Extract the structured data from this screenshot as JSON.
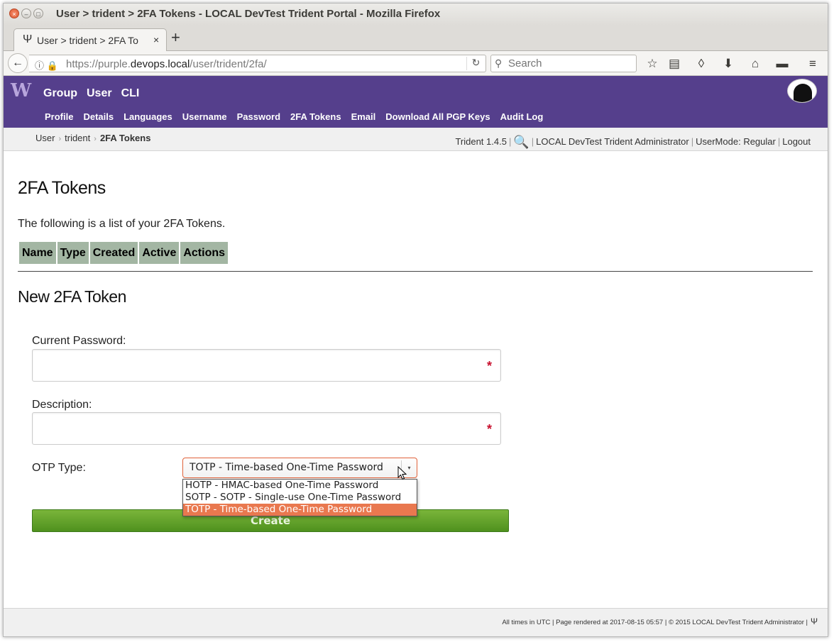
{
  "window": {
    "title": "User > trident > 2FA Tokens - LOCAL DevTest Trident Portal - Mozilla Firefox",
    "controls": {
      "close": "×",
      "minimize": "–",
      "maximize": "□"
    }
  },
  "browser": {
    "tab_icon": "Ψ",
    "tab_label": "User > trident > 2FA To",
    "tab_close": "×",
    "new_tab": "+",
    "back": "←",
    "url_security_icons": "ⓘ 🔒",
    "url_prefix": "https://purple.",
    "url_domain": "devops.local",
    "url_path": "/user/trident/2fa/",
    "reload": "↻",
    "search_icon": "⚲",
    "search_placeholder": "Search",
    "toolbar_icons": [
      "☆",
      "▤",
      "◊",
      "⬇",
      "⌂",
      "▬",
      "≡"
    ]
  },
  "site": {
    "logo": "W",
    "top_nav": [
      "Group",
      "User",
      "CLI"
    ],
    "sub_nav": [
      "Profile",
      "Details",
      "Languages",
      "Username",
      "Password",
      "2FA Tokens",
      "Email",
      "Download All PGP Keys",
      "Audit Log"
    ],
    "breadcrumb": {
      "items": [
        "User",
        "trident"
      ],
      "current": "2FA Tokens",
      "separator": "›"
    },
    "version": "Trident 1.4.5",
    "search_icon": "🔍",
    "admin_name": "LOCAL DevTest Trident Administrator",
    "usermode_label": "UserMode:",
    "usermode_value": "Regular",
    "logout": "Logout",
    "pipe": "|"
  },
  "page": {
    "title": "2FA Tokens",
    "intro": "The following is a list of your 2FA Tokens.",
    "table_headers": [
      "Name",
      "Type",
      "Created",
      "Active",
      "Actions"
    ],
    "new_title": "New 2FA Token",
    "form": {
      "current_password_label": "Current Password:",
      "description_label": "Description:",
      "required_mark": "*",
      "otp_type_label": "OTP Type:",
      "otp_selected": "TOTP - Time-based One-Time Password",
      "otp_options": [
        "HOTP - HMAC-based One-Time Password",
        "SOTP - SOTP - Single-use One-Time Password",
        "TOTP - Time-based One-Time Password"
      ],
      "otp_highlighted_index": 2,
      "select_arrow": "▾",
      "create_label": "Create"
    }
  },
  "footer": {
    "text": "All times in UTC | Page rendered at 2017-08-15 05:57 | © 2015 LOCAL DevTest Trident Administrator |",
    "logo": "Ψ"
  },
  "colors": {
    "site_header": "#553f8c",
    "table_header": "#a3b6a3",
    "create_button": "#5c9e28",
    "dropdown_highlight": "#e9784f",
    "required": "#c8102e"
  }
}
